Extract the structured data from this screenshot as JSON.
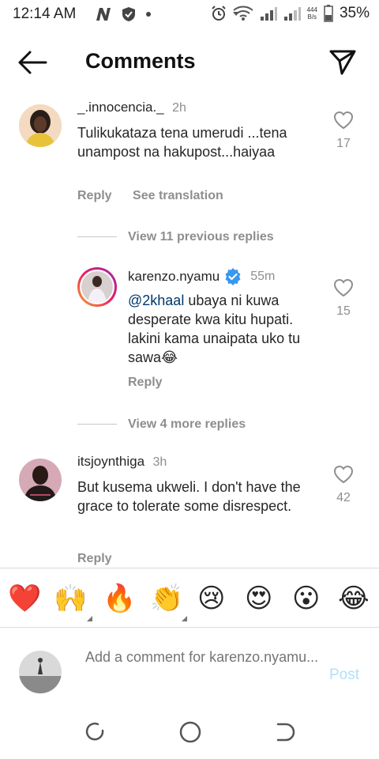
{
  "status_bar": {
    "time": "12:14 AM",
    "network_speed_value": "444",
    "network_speed_unit": "B/s",
    "battery": "35%"
  },
  "header": {
    "title": "Comments"
  },
  "comments": [
    {
      "username": "_.innocencia._",
      "time": "2h",
      "text": "Tulikukataza tena umerudi ...tena unampost na hakupost...haiyaa",
      "reply_label": "Reply",
      "translate_label": "See translation",
      "likes": "17"
    },
    {
      "username": "karenzo.nyamu",
      "verified": true,
      "time": "55m",
      "mention": "@2khaal",
      "text": " ubaya ni kuwa desperate kwa kitu hupati. lakini kama unaipata uko tu sawa😂",
      "reply_label": "Reply",
      "likes": "15"
    },
    {
      "username": "itsjoynthiga",
      "time": "3h",
      "text": "But kusema ukweli. I don't have the grace to tolerate some disrespect.",
      "reply_label": "Reply",
      "likes": "42"
    }
  ],
  "view_replies": [
    "View 11 previous replies",
    "View 4 more replies"
  ],
  "emoji_bar": [
    "❤️",
    "🙌",
    "🔥",
    "👏",
    "😢",
    "😍",
    "😮",
    "😂"
  ],
  "add_comment": {
    "placeholder": "Add a comment for karenzo.nyamu...",
    "post_label": "Post"
  },
  "colors": {
    "verified_blue": "#3897f0",
    "post_disabled": "#b2dffc",
    "secondary_text": "#8e8e8e",
    "heart_red": "#e0244b"
  }
}
